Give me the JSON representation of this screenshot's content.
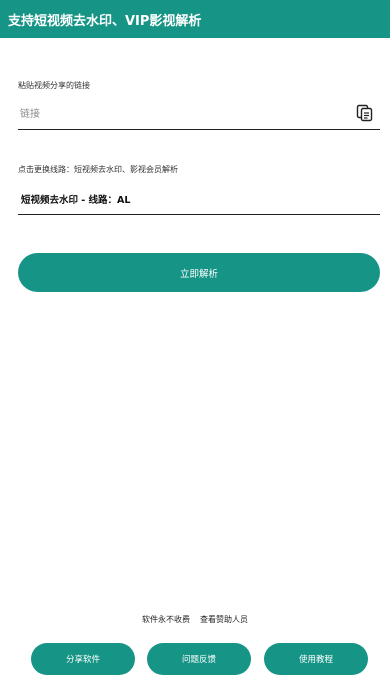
{
  "header": {
    "title": "支持短视频去水印、VIP影视解析"
  },
  "link_section": {
    "label": "粘贴视频分享的链接",
    "input_value": "",
    "input_placeholder": "链接",
    "paste_icon": "clipboard-paste-icon"
  },
  "line_section": {
    "label": "点击更换线路：短视频去水印、影视会员解析",
    "selected_line": "短视频去水印 - 线路：AL"
  },
  "parse_button": {
    "label": "立即解析"
  },
  "footer": {
    "free_text": "软件永不收费",
    "sponsors_link": "查看赞助人员"
  },
  "bottom_buttons": {
    "share": "分享软件",
    "feedback": "问题反馈",
    "tutorial": "使用教程"
  },
  "colors": {
    "primary": "#169587",
    "background": "#ffffff",
    "text": "#222222",
    "placeholder": "#8a8a8a"
  }
}
